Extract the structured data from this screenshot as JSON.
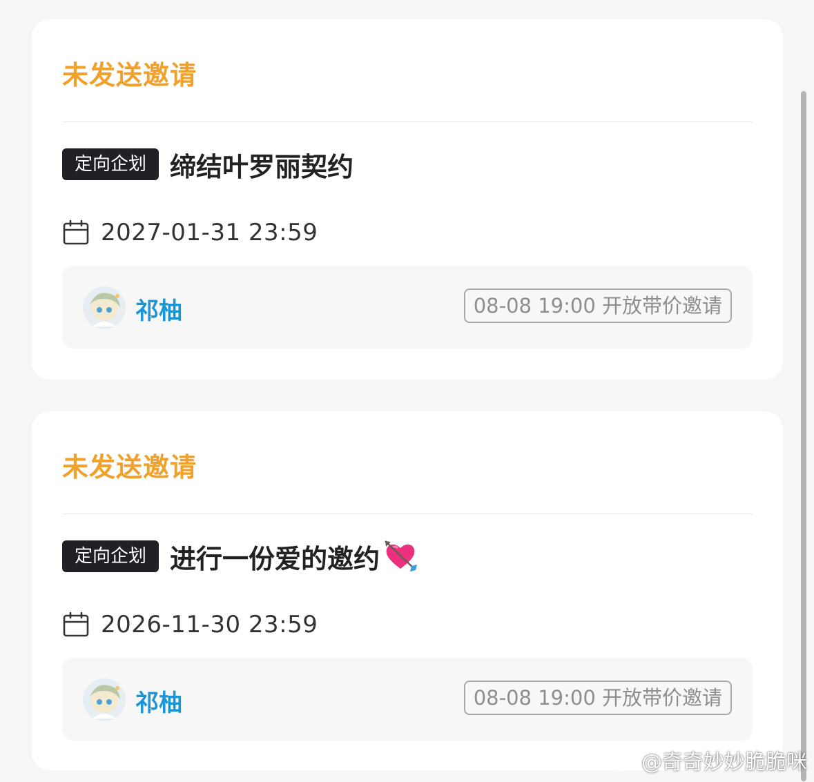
{
  "cards": [
    {
      "status": "未发送邀请",
      "tag": "定向企划",
      "title": "缔结叶罗丽契约",
      "title_emoji": "",
      "date": "2027-01-31 23:59",
      "author": "祁柚",
      "open_label": "08-08 19:00 开放带价邀请"
    },
    {
      "status": "未发送邀请",
      "tag": "定向企划",
      "title": "进行一份爱的邀约",
      "title_emoji": "heart-with-arrow",
      "date": "2026-11-30 23:59",
      "author": "祁柚",
      "open_label": "08-08 19:00 开放带价邀请"
    }
  ],
  "watermark": "@奇奇妙妙脆脆咪",
  "colors": {
    "status": "#f0a12b",
    "tag_bg": "#1f2127",
    "author": "#1a95d6",
    "page_bg": "#f5f6f8"
  },
  "icons": [
    "calendar-icon",
    "avatar",
    "heart-arrow-emoji",
    "weibo-icon"
  ]
}
